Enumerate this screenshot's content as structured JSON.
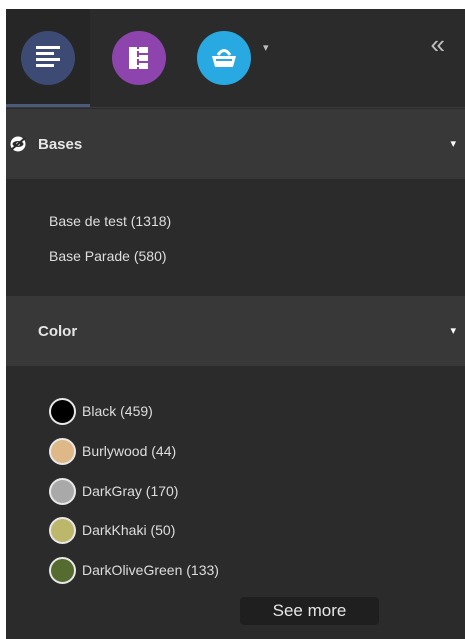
{
  "toolbar": {
    "tabs": [
      {
        "icon": "list-icon",
        "color": "#3d4b74"
      },
      {
        "icon": "tree-icon",
        "color": "#8e44ad"
      },
      {
        "icon": "basket-icon",
        "color": "#29a9e1"
      }
    ],
    "dropdown_caret": "▾",
    "collapse_symbol": "«"
  },
  "bases": {
    "title": "Bases",
    "chevron": "▾",
    "items": [
      {
        "label": "Base de test (1318)"
      },
      {
        "label": "Base Parade (580)"
      }
    ]
  },
  "color": {
    "title": "Color",
    "chevron": "▾",
    "items": [
      {
        "label": "Black (459)",
        "swatch": "#000000"
      },
      {
        "label": "Burlywood (44)",
        "swatch": "#deb887"
      },
      {
        "label": "DarkGray (170)",
        "swatch": "#a9a9a9"
      },
      {
        "label": "DarkKhaki (50)",
        "swatch": "#bdb76b"
      },
      {
        "label": "DarkOliveGreen (133)",
        "swatch": "#556b2f"
      }
    ],
    "see_more_label": "See more"
  }
}
